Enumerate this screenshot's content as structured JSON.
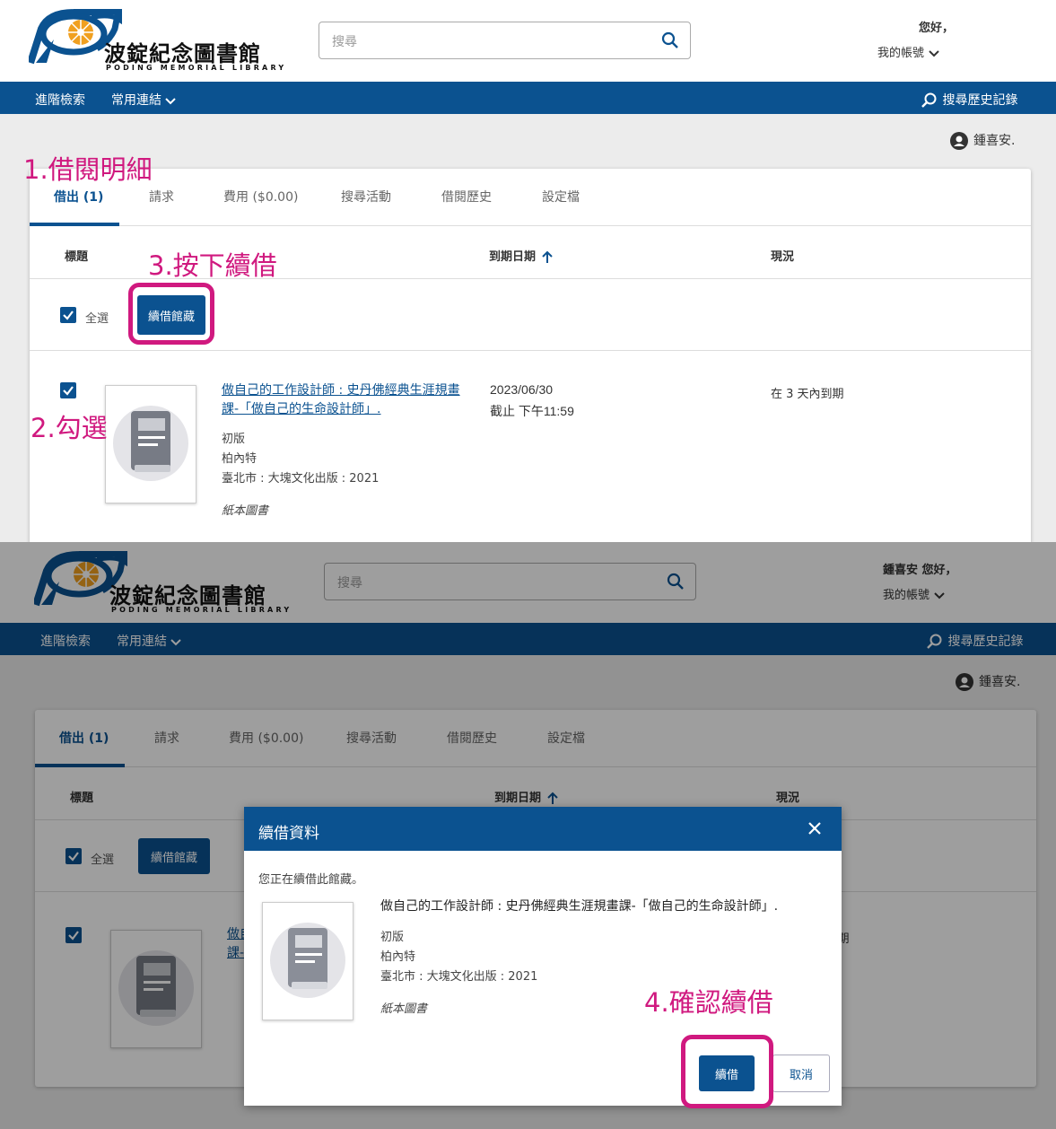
{
  "header": {
    "logo_cn": "波錠紀念圖書館",
    "logo_en": "PODING MEMORIAL LIBRARY",
    "search_placeholder": "搜尋",
    "greeting_top": "您好，",
    "greeting_bottom": "鍾喜安 您好，",
    "account_label": "我的帳號"
  },
  "navbar": {
    "advanced_search": "進階檢索",
    "common_links": "常用連結",
    "search_history": "搜尋歷史記錄"
  },
  "user": {
    "name": "鍾喜安."
  },
  "tabs": [
    {
      "label": "借出 (1)",
      "active": true
    },
    {
      "label": "請求"
    },
    {
      "label": "費用 ($0.00)"
    },
    {
      "label": "搜尋活動"
    },
    {
      "label": "借閱歷史"
    },
    {
      "label": "設定檔"
    }
  ],
  "table": {
    "col_title": "標題",
    "col_due": "到期日期",
    "col_status": "現況",
    "select_all": "全選",
    "renew_button": "續借館藏"
  },
  "item": {
    "title": "做自己的工作設計師 : 史丹佛經典生涯規畫課-「做自己的生命設計師」.",
    "edition": "初版",
    "author": "柏內特",
    "publisher": "臺北市 : 大塊文化出版 : 2021",
    "format": "紙本圖書",
    "due_date": "2023/06/30",
    "due_time": "截止 下午11:59",
    "status": "在 3 天內到期"
  },
  "modal": {
    "title": "續借資料",
    "message": "您正在續借此館藏。",
    "item_title": "做自己的工作設計師 : 史丹佛經典生涯規畫課-「做自己的生命設計師」.",
    "renew_button": "續借",
    "cancel_button": "取消"
  },
  "annotations": {
    "step1": "1.借閱明細",
    "step2": "2.勾選",
    "step3": "3.按下續借",
    "step4": "4.確認續借"
  },
  "colors": {
    "brand_blue": "#0b5290",
    "annotation_magenta": "#d0197f"
  }
}
